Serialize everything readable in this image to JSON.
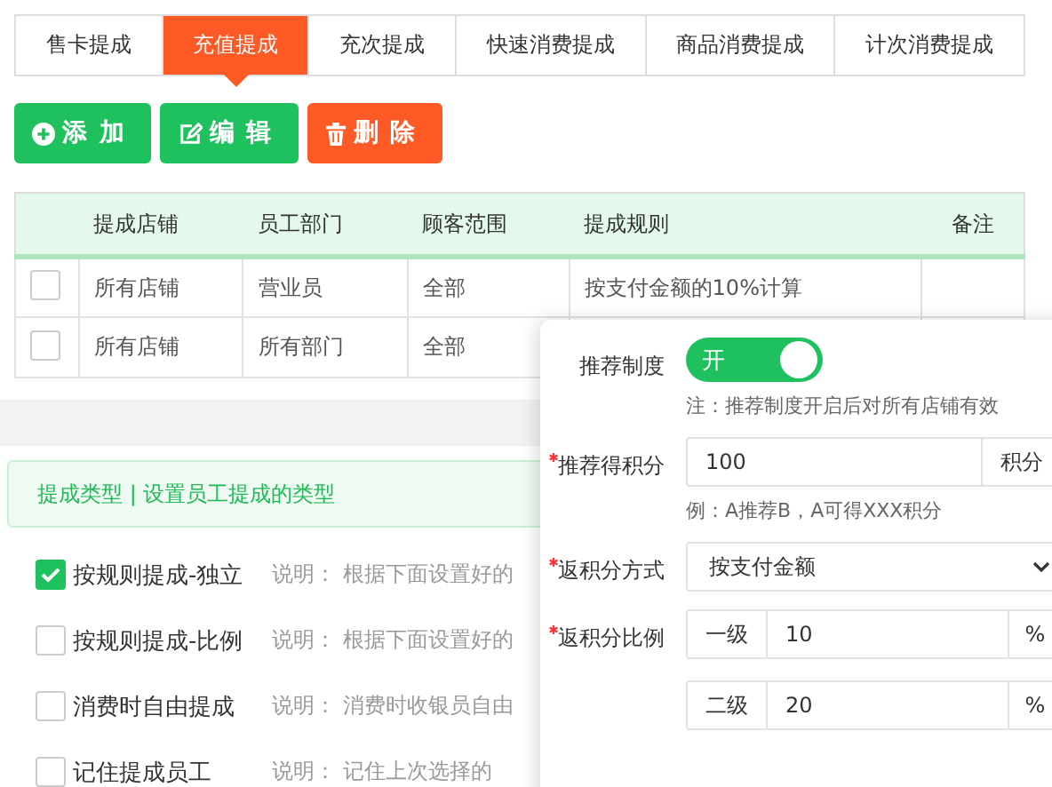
{
  "tabs": [
    {
      "label": "售卡提成",
      "selected": false
    },
    {
      "label": "充值提成",
      "selected": true
    },
    {
      "label": "充次提成",
      "selected": false
    },
    {
      "label": "快速消费提成",
      "selected": false
    },
    {
      "label": "商品消费提成",
      "selected": false
    },
    {
      "label": "计次消费提成",
      "selected": false
    }
  ],
  "buttons": [
    {
      "kind": "add",
      "label": "添 加"
    },
    {
      "kind": "edit",
      "label": "编 辑"
    },
    {
      "kind": "delete",
      "label": "删 除"
    }
  ],
  "table": {
    "columns": [
      "提成店铺",
      "员工部门",
      "顾客范围",
      "提成规则",
      "备注"
    ],
    "rows": [
      {
        "checked": false,
        "cells": [
          "所有店铺",
          "营业员",
          "全部",
          "按支付金额的10%计算",
          ""
        ]
      },
      {
        "checked": false,
        "cells": [
          "所有店铺",
          "所有部门",
          "全部",
          "",
          ""
        ]
      }
    ]
  },
  "section": {
    "title": "提成类型 | 设置员工提成的类型",
    "options": [
      {
        "label": "按规则提成-独立",
        "checked": true,
        "note": "说明： 根据下面设置好的"
      },
      {
        "label": "按规则提成-比例",
        "checked": false,
        "note": "说明： 根据下面设置好的"
      },
      {
        "label": "消费时自由提成",
        "checked": false,
        "note": "说明： 消费时收银员自由"
      },
      {
        "label": "记住提成员工",
        "checked": false,
        "note": "说明： 记住上次选择的"
      }
    ]
  },
  "popup": {
    "fields": [
      {
        "kind": "switch",
        "label": "推荐制度",
        "required": false,
        "on": true,
        "on_text": "开",
        "note": "注：推荐制度开启后对所有店铺有效"
      },
      {
        "kind": "input",
        "label": "推荐得积分",
        "required": true,
        "value": "100",
        "suffix": "积分",
        "note": "例：A推荐B，A可得XXX积分"
      },
      {
        "kind": "select",
        "label": "返积分方式",
        "required": true,
        "value": "按支付金额"
      },
      {
        "kind": "levels",
        "label": "返积分比例",
        "required": true,
        "levels": [
          {
            "prefix": "一级",
            "value": "10",
            "suffix": "%"
          },
          {
            "prefix": "二级",
            "value": "20",
            "suffix": "%"
          }
        ]
      }
    ]
  }
}
